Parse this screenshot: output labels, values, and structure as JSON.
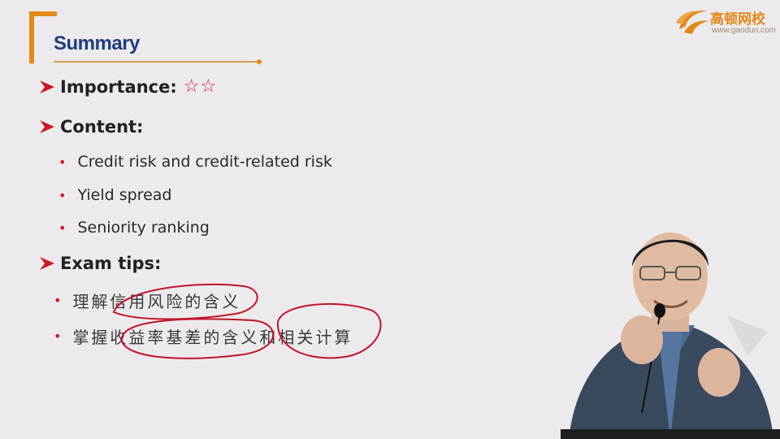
{
  "slide": {
    "title": "Summary",
    "importance": {
      "label": "Importance:",
      "stars": "☆☆"
    },
    "content": {
      "label": "Content:",
      "items": [
        "Credit risk and credit-related risk",
        "Yield spread",
        "Seniority ranking"
      ]
    },
    "exam_tips": {
      "label": "Exam tips:",
      "items": [
        "理解信用风险的含义",
        "掌握收益率基差的含义和相关计算"
      ]
    }
  },
  "logo": {
    "name": "高顿网校",
    "url": "www.gaodun.com"
  },
  "colors": {
    "background": "#eceaec",
    "title": "#1f3e7a",
    "accent_orange": "#e38b19",
    "bullet_red": "#c81b23",
    "annotation_ink": "#c0162a"
  },
  "icons": [
    "arrow-bullet-icon",
    "star-outline-icon",
    "logo-mark-icon"
  ]
}
